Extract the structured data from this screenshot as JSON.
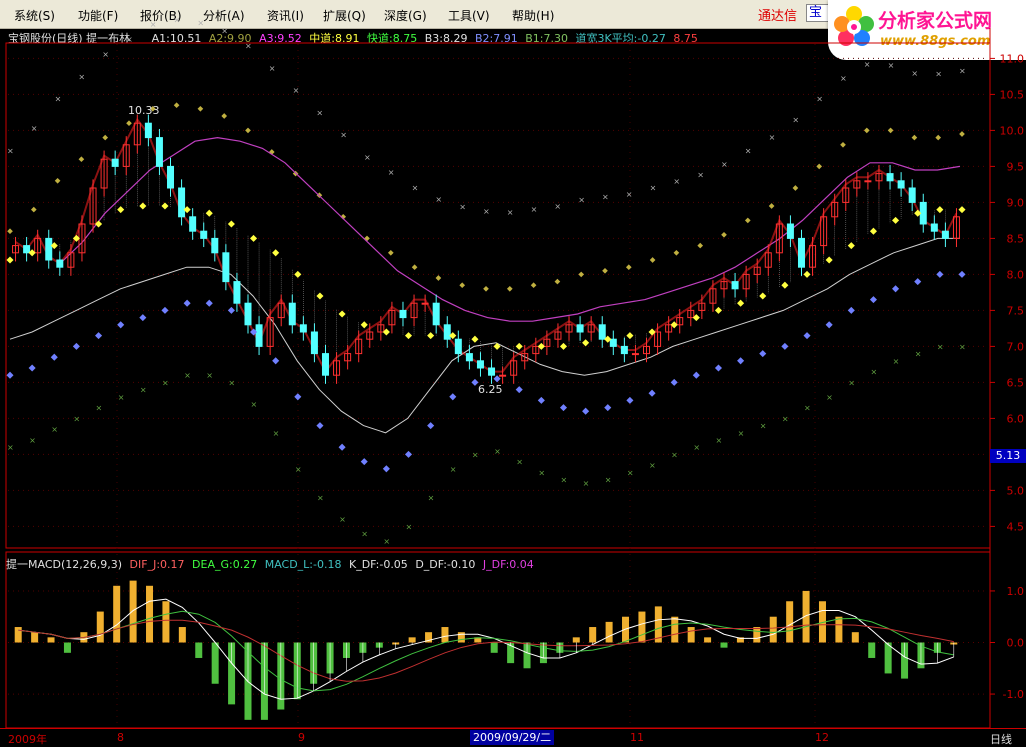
{
  "menu": [
    "系统(S)",
    "功能(F)",
    "报价(B)",
    "分析(A)",
    "资讯(I)",
    "扩展(Q)",
    "深度(G)",
    "工具(V)",
    "帮助(H)"
  ],
  "brand": {
    "name": "通达信",
    "box": "宝",
    "logo_title": "分析家公式网",
    "logo_url": "www.88gs.com"
  },
  "main_info": {
    "title": "宝钢股份(日线) 提一布林",
    "a1": "A1:10.51",
    "a2": "A2:9.90",
    "a3": "A3:9.52",
    "mid": "中道:8.91",
    "fast": "快道:8.75",
    "b3": "B3:8.29",
    "b2": "B2:7.91",
    "b1": "B1:7.30",
    "width": "道宽3K平均:-0.27",
    "last": "8.75"
  },
  "sub_info": {
    "title": "提一MACD(12,26,9,3)",
    "dif": "DIF_J:0.17",
    "dea": "DEA_G:0.27",
    "macd": "MACD_L:-0.18",
    "kdf": "K_DF:-0.05",
    "ddf": "D_DF:-0.10",
    "jdf": "J_DF:0.04"
  },
  "price_axis": [
    "11.0",
    "10.5",
    "10.0",
    "9.5",
    "9.0",
    "8.5",
    "8.0",
    "7.5",
    "7.0",
    "6.5",
    "6.0",
    "5.5",
    "5.0",
    "4.5"
  ],
  "current_price": "5.13",
  "macd_axis": [
    "1.0",
    "0.0",
    "-1.0"
  ],
  "annotations": {
    "high": "10.33",
    "low": "6.25"
  },
  "bottom_axis": {
    "year": "2009年",
    "m8": "8",
    "m9": "9",
    "cursor": "2009/09/29/二",
    "m11": "11",
    "m12": "12",
    "period": "日线"
  },
  "colors": {
    "up": "#ff3030",
    "down": "#54ffff",
    "mid_dots": "#ffff40",
    "lower_dots": "#7080ff",
    "upper_dots": "#c0b040",
    "magenta": "#c040c0",
    "bg": "#000000",
    "axis": "#cc0000"
  },
  "chart_data": {
    "type": "candlestick",
    "ylim": [
      4.2,
      11.2
    ],
    "close": [
      8.4,
      8.3,
      8.5,
      8.2,
      8.1,
      8.3,
      8.7,
      9.2,
      9.6,
      9.5,
      9.8,
      10.1,
      9.9,
      9.5,
      9.2,
      8.8,
      8.6,
      8.5,
      8.3,
      7.9,
      7.6,
      7.3,
      7.0,
      7.4,
      7.6,
      7.3,
      7.2,
      6.9,
      6.6,
      6.8,
      6.9,
      7.1,
      7.2,
      7.3,
      7.5,
      7.4,
      7.6,
      7.6,
      7.3,
      7.1,
      6.9,
      6.8,
      6.7,
      6.6,
      6.6,
      6.8,
      6.9,
      7.0,
      7.1,
      7.2,
      7.3,
      7.2,
      7.3,
      7.1,
      7.0,
      6.9,
      6.9,
      7.0,
      7.2,
      7.3,
      7.4,
      7.5,
      7.6,
      7.8,
      7.9,
      7.8,
      8.0,
      8.1,
      8.3,
      8.7,
      8.5,
      8.1,
      8.4,
      8.8,
      9.0,
      9.2,
      9.3,
      9.3,
      9.4,
      9.3,
      9.2,
      9.0,
      8.7,
      8.6,
      8.5,
      8.8
    ],
    "mid_dots": [
      8.2,
      8.3,
      8.4,
      8.5,
      8.7,
      8.9,
      8.95,
      8.95,
      8.9,
      8.85,
      8.7,
      8.5,
      8.3,
      8.0,
      7.7,
      7.45,
      7.3,
      7.2,
      7.15,
      7.15,
      7.15,
      7.1,
      7.0,
      7.0,
      7.0,
      7.0,
      7.05,
      7.1,
      7.15,
      7.2,
      7.3,
      7.4,
      7.5,
      7.6,
      7.7,
      7.85,
      8.0,
      8.2,
      8.4,
      8.6,
      8.75,
      8.85,
      8.9,
      8.9
    ],
    "lower_dots": [
      6.6,
      6.7,
      6.85,
      7.0,
      7.15,
      7.3,
      7.4,
      7.5,
      7.6,
      7.6,
      7.5,
      7.2,
      6.8,
      6.3,
      5.9,
      5.6,
      5.4,
      5.3,
      5.5,
      5.9,
      6.3,
      6.5,
      6.55,
      6.4,
      6.25,
      6.15,
      6.1,
      6.15,
      6.25,
      6.35,
      6.5,
      6.6,
      6.7,
      6.8,
      6.9,
      7.0,
      7.15,
      7.3,
      7.5,
      7.65,
      7.8,
      7.9,
      8.0,
      8.0
    ],
    "upper_dots": [
      8.6,
      8.9,
      9.3,
      9.6,
      9.9,
      10.1,
      10.3,
      10.35,
      10.3,
      10.2,
      10.0,
      9.7,
      9.4,
      9.1,
      8.8,
      8.5,
      8.3,
      8.1,
      7.95,
      7.85,
      7.8,
      7.8,
      7.85,
      7.9,
      8.0,
      8.05,
      8.1,
      8.2,
      8.3,
      8.4,
      8.55,
      8.75,
      8.95,
      9.2,
      9.5,
      9.8,
      10.0,
      10.0,
      9.9,
      9.9,
      9.95
    ],
    "macd_bars": [
      0.3,
      0.2,
      0.1,
      -0.2,
      0.2,
      0.6,
      1.1,
      1.2,
      1.1,
      0.8,
      0.3,
      -0.3,
      -0.8,
      -1.2,
      -1.5,
      -1.5,
      -1.3,
      -1.1,
      -0.8,
      -0.6,
      -0.3,
      -0.2,
      -0.1,
      0.0,
      0.1,
      0.2,
      0.3,
      0.2,
      0.1,
      -0.2,
      -0.4,
      -0.5,
      -0.4,
      -0.2,
      0.1,
      0.3,
      0.4,
      0.5,
      0.6,
      0.7,
      0.5,
      0.3,
      0.1,
      -0.1,
      0.1,
      0.3,
      0.5,
      0.8,
      1.0,
      0.8,
      0.5,
      0.2,
      -0.3,
      -0.6,
      -0.7,
      -0.5,
      -0.2,
      0.0
    ]
  }
}
